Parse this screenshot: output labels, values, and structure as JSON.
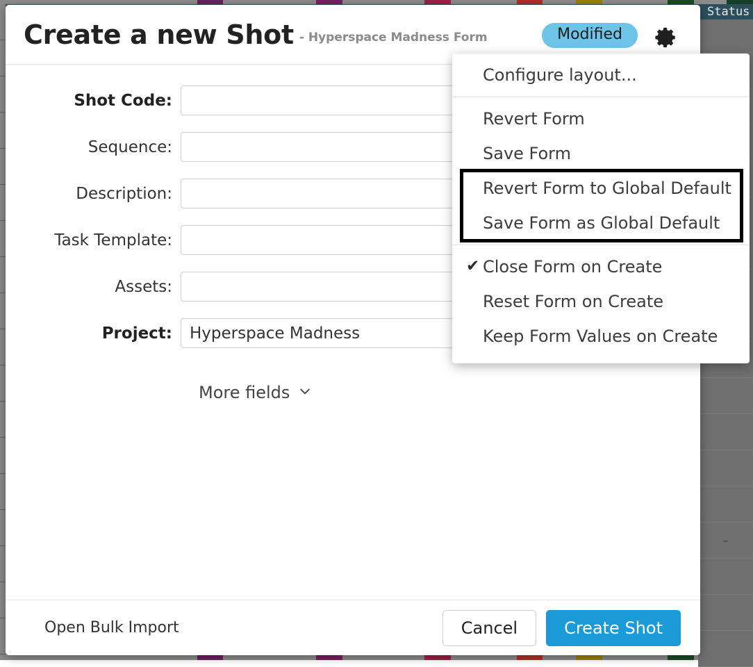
{
  "background": {
    "status_column_header": "Status",
    "row_placeholder": "–",
    "row_count": 18,
    "rows_with_dash": [
      4,
      8,
      14
    ],
    "header_bar_color": "#2c4f5e",
    "grid_color": "#6f6f6f",
    "column_strip_colors": [
      "#8c8c8c",
      "#6b2060",
      "#8c8c8c",
      "#7a2060",
      "#8c8c8c",
      "#9e2047",
      "#8c8c8c",
      "#b03028",
      "#8c8c8c",
      "#9a8008",
      "#8c8c8c",
      "#1d4a25",
      "#8c8c8c",
      "#14402a"
    ]
  },
  "dialog": {
    "title": "Create a new Shot",
    "subtitle": "- Hyperspace Madness Form",
    "modified_badge": "Modified",
    "modified_badge_color": "#6ec4e8",
    "gear_icon": "gear-icon",
    "fields": [
      {
        "label": "Shot Code:",
        "value": "",
        "placeholder": "",
        "required": true
      },
      {
        "label": "Sequence:",
        "value": "",
        "placeholder": "",
        "required": false
      },
      {
        "label": "Description:",
        "value": "",
        "placeholder": "",
        "required": false
      },
      {
        "label": "Task Template:",
        "value": "",
        "placeholder": "",
        "required": false
      },
      {
        "label": "Assets:",
        "value": "",
        "placeholder": "",
        "required": false
      },
      {
        "label": "Project:",
        "value": "Hyperspace Madness",
        "placeholder": "",
        "required": true
      }
    ],
    "more_fields_label": "More fields",
    "more_fields_icon": "chevron-down-icon",
    "footer": {
      "bulk_import_label": "Open Bulk Import",
      "cancel_label": "Cancel",
      "create_label": "Create Shot",
      "create_button_color": "#1a9bd7"
    }
  },
  "gear_menu": {
    "items": [
      {
        "label": "Configure layout...",
        "checked": false
      },
      {
        "label": "Revert Form",
        "checked": false
      },
      {
        "label": "Save Form",
        "checked": false
      },
      {
        "label": "Revert Form to Global Default",
        "checked": false
      },
      {
        "label": "Save Form as Global Default",
        "checked": false
      },
      {
        "label": "Close Form on Create",
        "checked": true
      },
      {
        "label": "Reset Form on Create",
        "checked": false
      },
      {
        "label": "Keep Form Values on Create",
        "checked": false
      }
    ],
    "check_glyph": "✔",
    "highlight_border_color": "#000000",
    "highlighted_items": [
      "Revert Form to Global Default",
      "Save Form as Global Default"
    ]
  }
}
